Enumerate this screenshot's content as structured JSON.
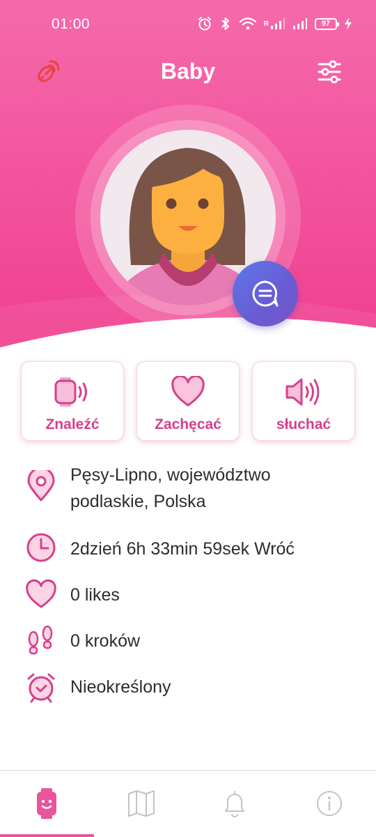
{
  "status_bar": {
    "time": "01:00",
    "battery": "97",
    "signal_r": "R"
  },
  "header": {
    "title": "Baby",
    "left_icon": "satellite-icon",
    "right_icon": "sliders-icon",
    "chat_icon": "chat-bubble-icon"
  },
  "actions": [
    {
      "label": "Znaleźć",
      "icon": "watch-ring-icon"
    },
    {
      "label": "Zachęcać",
      "icon": "heart-icon"
    },
    {
      "label": "słuchać",
      "icon": "speaker-icon"
    }
  ],
  "info": {
    "location": "Pęsy-Lipno, województwo podlaskie, Polska",
    "duration": "2dzień 6h 33min 59sek Wróć",
    "likes": "0 likes",
    "steps": "0 kroków",
    "alarm": "Nieokreślony"
  },
  "bottom_nav": [
    {
      "icon": "watch-icon",
      "active": true
    },
    {
      "icon": "map-icon",
      "active": false
    },
    {
      "icon": "bell-icon",
      "active": false
    },
    {
      "icon": "info-icon",
      "active": false
    }
  ],
  "colors": {
    "accent": "#e8559c",
    "header_top": "#f46aaa",
    "header_bottom": "#f03d8f",
    "action_text": "#d73f8c",
    "chat_button": "#5b78e8"
  }
}
